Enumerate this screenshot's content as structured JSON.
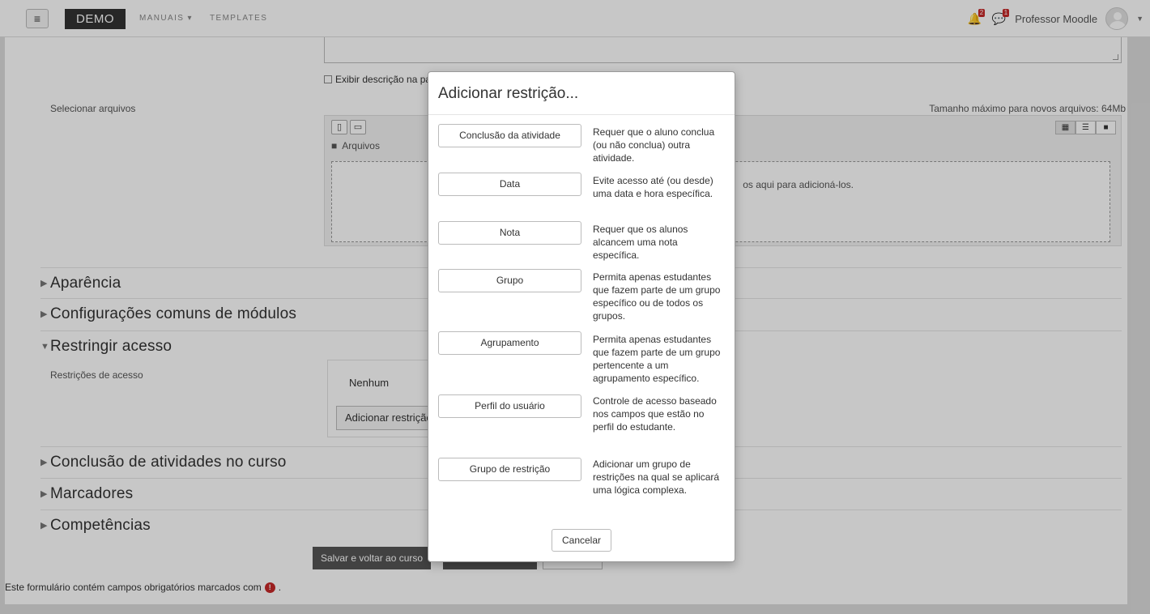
{
  "navbar": {
    "menu_icon": "hamburger-icon",
    "brand": "DEMO",
    "links": [
      "MANUAIS ▾",
      "TEMPLATES"
    ],
    "notifications_count": "2",
    "messages_count": "1",
    "user_name": "Professor Moodle"
  },
  "form": {
    "display_description_label": "Exibir descrição na pá",
    "select_files_label": "Selecionar arquivos",
    "max_size": "Tamanho máximo para novos arquivos: 64Mb",
    "files_path": "Arquivos",
    "drop_hint": "os aqui para adicioná-los.",
    "sections": [
      {
        "title": "Aparência",
        "expanded": false
      },
      {
        "title": "Configurações comuns de módulos",
        "expanded": false
      },
      {
        "title": "Restringir acesso",
        "expanded": true
      },
      {
        "title": "Conclusão de atividades no curso",
        "expanded": false
      },
      {
        "title": "Marcadores",
        "expanded": false
      },
      {
        "title": "Competências",
        "expanded": false
      }
    ],
    "access_restrictions_label": "Restrições de acesso",
    "restrictions_none": "Nenhum",
    "add_restriction_button": "Adicionar restrição...",
    "save_return_button": "Salvar e voltar ao curso",
    "required_note": "Este formulário contém campos obrigatórios marcados com",
    "required_note_end": "."
  },
  "modal": {
    "title": "Adicionar restrição...",
    "options": [
      {
        "label": "Conclusão da atividade",
        "description": "Requer que o aluno conclua (ou não conclua) outra atividade."
      },
      {
        "label": "Data",
        "description": "Evite acesso até (ou desde) uma data e hora específica."
      },
      {
        "label": "Nota",
        "description": "Requer que os alunos alcancem uma nota específica."
      },
      {
        "label": "Grupo",
        "description": "Permita apenas estudantes que fazem parte de um grupo específico ou de todos os grupos."
      },
      {
        "label": "Agrupamento",
        "description": "Permita apenas estudantes que fazem parte de um grupo pertencente a um agrupamento específico."
      },
      {
        "label": "Perfil do usuário",
        "description": "Controle de acesso baseado nos campos que estão no perfil do estudante."
      },
      {
        "label": "Grupo de restrição",
        "description": "Adicionar um grupo de restrições na qual se aplicará uma lógica complexa."
      }
    ],
    "cancel_button": "Cancelar"
  }
}
